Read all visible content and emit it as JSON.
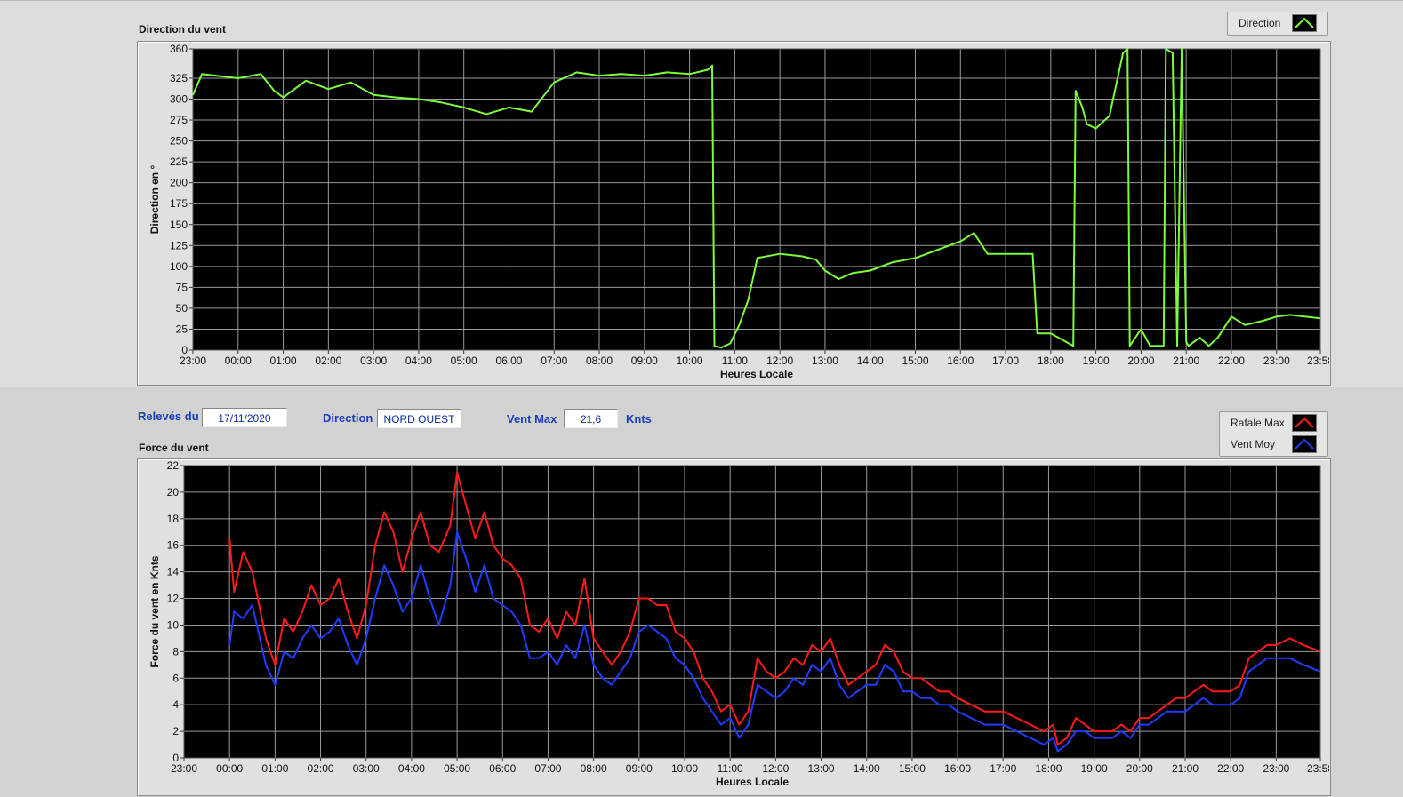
{
  "info": {
    "releves_label": "Relevés du",
    "date": "17/11/2020",
    "direction_label": "Direction",
    "direction_value": "NORD OUEST",
    "ventmax_label": "Vent Max",
    "ventmax_value": "21,6",
    "unit": "Knts"
  },
  "legends": {
    "direction": "Direction",
    "rafale": "Rafale Max",
    "ventmoy": "Vent Moy"
  },
  "colors": {
    "direction": "#7CFC3A",
    "rafale": "#ff1a1a",
    "ventmoy": "#1f3cff",
    "plot_bg": "#000000",
    "grid": "#9a9a9a"
  },
  "chart_data": [
    {
      "type": "line",
      "title": "Direction du vent",
      "xlabel": "Heures Locale",
      "ylabel": "Direction en °",
      "ylim": [
        0,
        360
      ],
      "yticks": [
        0,
        25,
        50,
        75,
        100,
        125,
        150,
        175,
        200,
        225,
        250,
        275,
        300,
        325,
        360
      ],
      "xticks": [
        "23:00",
        "00:00",
        "01:00",
        "02:00",
        "03:00",
        "04:00",
        "05:00",
        "06:00",
        "07:00",
        "08:00",
        "09:00",
        "10:00",
        "11:00",
        "12:00",
        "13:00",
        "14:00",
        "15:00",
        "16:00",
        "17:00",
        "18:00",
        "19:00",
        "20:00",
        "21:00",
        "22:00",
        "23:00",
        "23:58"
      ],
      "series": [
        {
          "name": "Direction",
          "x": [
            0,
            0.2,
            0.5,
            1.0,
            1.5,
            1.8,
            2.0,
            2.5,
            3.0,
            3.5,
            4.0,
            4.5,
            5.0,
            5.5,
            6.0,
            6.5,
            7.0,
            7.5,
            8.0,
            8.5,
            9.0,
            9.5,
            10.0,
            10.5,
            11.0,
            11.4,
            11.5,
            11.55,
            11.7,
            11.9,
            12.1,
            12.3,
            12.5,
            13.0,
            13.5,
            13.8,
            14.0,
            14.3,
            14.6,
            15.0,
            15.5,
            16.0,
            16.5,
            17.0,
            17.3,
            17.6,
            18.0,
            18.6,
            18.7,
            19.0,
            19.5,
            19.55,
            19.7,
            19.8,
            20.0,
            20.3,
            20.5,
            20.6,
            20.7,
            20.75,
            21.0,
            21.2,
            21.5,
            21.55,
            21.7,
            21.8,
            21.9,
            22.0,
            22.05,
            22.3,
            22.5,
            22.7,
            23.0,
            23.3,
            23.7,
            24.0,
            24.3,
            24.97
          ],
          "y": [
            305,
            330,
            328,
            325,
            330,
            310,
            302,
            322,
            312,
            320,
            305,
            302,
            300,
            296,
            290,
            282,
            290,
            285,
            320,
            332,
            328,
            330,
            328,
            332,
            330,
            335,
            340,
            5,
            3,
            8,
            30,
            60,
            110,
            115,
            112,
            108,
            95,
            85,
            92,
            95,
            105,
            110,
            120,
            130,
            140,
            115,
            115,
            115,
            20,
            20,
            5,
            310,
            290,
            270,
            265,
            280,
            330,
            355,
            360,
            5,
            25,
            5,
            5,
            360,
            355,
            5,
            360,
            10,
            5,
            15,
            5,
            15,
            40,
            30,
            35,
            40,
            42,
            38
          ]
        }
      ]
    },
    {
      "type": "line",
      "title": "Force du vent",
      "xlabel": "Heures Locale",
      "ylabel": "Force du vent en Knts",
      "ylim": [
        0,
        22
      ],
      "yticks": [
        0,
        2,
        4,
        6,
        8,
        10,
        12,
        14,
        16,
        18,
        20,
        22
      ],
      "xticks": [
        "23:00",
        "00:00",
        "01:00",
        "02:00",
        "03:00",
        "04:00",
        "05:00",
        "06:00",
        "07:00",
        "08:00",
        "09:00",
        "10:00",
        "11:00",
        "12:00",
        "13:00",
        "14:00",
        "15:00",
        "16:00",
        "17:00",
        "18:00",
        "19:00",
        "20:00",
        "21:00",
        "22:00",
        "23:00",
        "23:58"
      ],
      "series": [
        {
          "name": "Rafale Max",
          "x": [
            1.0,
            1.1,
            1.3,
            1.5,
            1.8,
            2.0,
            2.2,
            2.4,
            2.6,
            2.8,
            3.0,
            3.2,
            3.4,
            3.6,
            3.8,
            4.0,
            4.2,
            4.4,
            4.6,
            4.8,
            5.0,
            5.2,
            5.4,
            5.6,
            5.85,
            6.0,
            6.2,
            6.4,
            6.6,
            6.8,
            7.0,
            7.2,
            7.4,
            7.6,
            7.8,
            8.0,
            8.2,
            8.4,
            8.6,
            8.8,
            9.0,
            9.2,
            9.4,
            9.6,
            9.8,
            10.0,
            10.2,
            10.4,
            10.6,
            10.8,
            11.0,
            11.2,
            11.4,
            11.6,
            11.8,
            12.0,
            12.2,
            12.4,
            12.6,
            12.8,
            13.0,
            13.2,
            13.4,
            13.6,
            13.8,
            14.0,
            14.2,
            14.4,
            14.6,
            14.8,
            15.0,
            15.2,
            15.4,
            15.6,
            15.8,
            16.0,
            16.2,
            16.4,
            16.6,
            16.8,
            17.0,
            17.3,
            17.6,
            18.0,
            18.3,
            18.6,
            18.9,
            19.1,
            19.2,
            19.4,
            19.6,
            19.8,
            20.0,
            20.2,
            20.4,
            20.6,
            20.8,
            21.0,
            21.2,
            21.4,
            21.6,
            21.8,
            22.0,
            22.2,
            22.4,
            22.6,
            22.8,
            23.0,
            23.2,
            23.4,
            23.6,
            23.8,
            24.0,
            24.3,
            24.6,
            24.97
          ],
          "y": [
            16.5,
            12.5,
            15.5,
            14.0,
            9.0,
            7.0,
            10.5,
            9.5,
            11.0,
            13.0,
            11.5,
            12.0,
            13.5,
            11.0,
            9.0,
            11.5,
            16.0,
            18.5,
            17.0,
            14.0,
            16.5,
            18.5,
            16.0,
            15.5,
            17.5,
            21.5,
            19.0,
            16.5,
            18.5,
            16.0,
            15.0,
            14.5,
            13.5,
            10.0,
            9.5,
            10.5,
            9.0,
            11.0,
            10.0,
            13.5,
            9.0,
            8.0,
            7.0,
            8.0,
            9.5,
            12.0,
            12.0,
            11.5,
            11.5,
            9.5,
            9.0,
            8.0,
            6.0,
            5.0,
            3.5,
            4.0,
            2.5,
            3.5,
            7.5,
            6.5,
            6.0,
            6.5,
            7.5,
            7.0,
            8.5,
            8.0,
            9.0,
            7.0,
            5.5,
            6.0,
            6.5,
            7.0,
            8.5,
            8.0,
            6.5,
            6.0,
            6.0,
            5.5,
            5.0,
            5.0,
            4.5,
            4.0,
            3.5,
            3.5,
            3.0,
            2.5,
            2.0,
            2.5,
            1.0,
            1.5,
            3.0,
            2.5,
            2.0,
            2.0,
            2.0,
            2.5,
            2.0,
            3.0,
            3.0,
            3.5,
            4.0,
            4.5,
            4.5,
            5.0,
            5.5,
            5.0,
            5.0,
            5.0,
            5.5,
            7.5,
            8.0,
            8.5,
            8.5,
            9.0,
            8.5,
            8.0
          ]
        },
        {
          "name": "Vent Moy",
          "x": [
            1.0,
            1.1,
            1.3,
            1.5,
            1.8,
            2.0,
            2.2,
            2.4,
            2.6,
            2.8,
            3.0,
            3.2,
            3.4,
            3.6,
            3.8,
            4.0,
            4.2,
            4.4,
            4.6,
            4.8,
            5.0,
            5.2,
            5.4,
            5.6,
            5.85,
            6.0,
            6.2,
            6.4,
            6.6,
            6.8,
            7.0,
            7.2,
            7.4,
            7.6,
            7.8,
            8.0,
            8.2,
            8.4,
            8.6,
            8.8,
            9.0,
            9.2,
            9.4,
            9.6,
            9.8,
            10.0,
            10.2,
            10.4,
            10.6,
            10.8,
            11.0,
            11.2,
            11.4,
            11.6,
            11.8,
            12.0,
            12.2,
            12.4,
            12.6,
            12.8,
            13.0,
            13.2,
            13.4,
            13.6,
            13.8,
            14.0,
            14.2,
            14.4,
            14.6,
            14.8,
            15.0,
            15.2,
            15.4,
            15.6,
            15.8,
            16.0,
            16.2,
            16.4,
            16.6,
            16.8,
            17.0,
            17.3,
            17.6,
            18.0,
            18.3,
            18.6,
            18.9,
            19.1,
            19.2,
            19.4,
            19.6,
            19.8,
            20.0,
            20.2,
            20.4,
            20.6,
            20.8,
            21.0,
            21.2,
            21.4,
            21.6,
            21.8,
            22.0,
            22.2,
            22.4,
            22.6,
            22.8,
            23.0,
            23.2,
            23.4,
            23.6,
            23.8,
            24.0,
            24.3,
            24.6,
            24.97
          ],
          "y": [
            8.5,
            11.0,
            10.5,
            11.5,
            7.0,
            5.5,
            8.0,
            7.5,
            9.0,
            10.0,
            9.0,
            9.5,
            10.5,
            8.5,
            7.0,
            9.0,
            12.0,
            14.5,
            13.0,
            11.0,
            12.0,
            14.5,
            12.0,
            10.0,
            13.0,
            17.0,
            15.0,
            12.5,
            14.5,
            12.0,
            11.5,
            11.0,
            10.0,
            7.5,
            7.5,
            8.0,
            7.0,
            8.5,
            7.5,
            10.0,
            7.0,
            6.0,
            5.5,
            6.5,
            7.5,
            9.5,
            10.0,
            9.5,
            9.0,
            7.5,
            7.0,
            6.0,
            4.5,
            3.5,
            2.5,
            3.0,
            1.5,
            2.5,
            5.5,
            5.0,
            4.5,
            5.0,
            6.0,
            5.5,
            7.0,
            6.5,
            7.5,
            5.5,
            4.5,
            5.0,
            5.5,
            5.5,
            7.0,
            6.5,
            5.0,
            5.0,
            4.5,
            4.5,
            4.0,
            4.0,
            3.5,
            3.0,
            2.5,
            2.5,
            2.0,
            1.5,
            1.0,
            1.5,
            0.5,
            1.0,
            2.0,
            2.0,
            1.5,
            1.5,
            1.5,
            2.0,
            1.5,
            2.5,
            2.5,
            3.0,
            3.5,
            3.5,
            3.5,
            4.0,
            4.5,
            4.0,
            4.0,
            4.0,
            4.5,
            6.5,
            7.0,
            7.5,
            7.5,
            7.5,
            7.0,
            6.5
          ]
        }
      ]
    }
  ]
}
